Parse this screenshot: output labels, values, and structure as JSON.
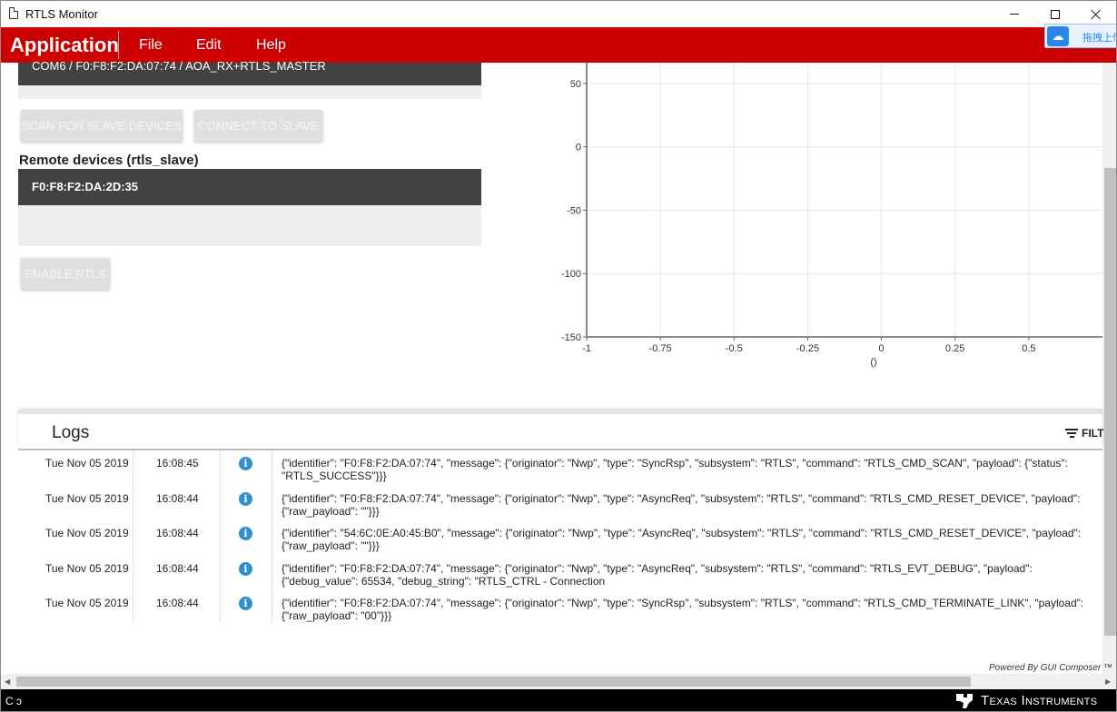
{
  "window": {
    "title": "RTLS Monitor"
  },
  "menubar": {
    "app_title": "Application",
    "items": [
      "File",
      "Edit",
      "Help"
    ],
    "overlay_text": "拖拽上传"
  },
  "left_panel": {
    "port_label": "COM6 / F0:F8:F2:DA:07:74 / AOA_RX+RTLS_MASTER",
    "scan_button": "SCAN FOR SLAVE DEVICES",
    "connect_button": "CONNECT TO SLAVE",
    "remote_heading": "Remote devices (rtls_slave)",
    "remote_devices": [
      "F0:F8:F2:DA:2D:35"
    ],
    "enable_button": "ENABLE RTLS"
  },
  "chart_data": {
    "type": "scatter",
    "series": [],
    "xlabel": "()",
    "x_ticks": [
      "-1",
      "-0.75",
      "-0.5",
      "-0.25",
      "0",
      "0.25",
      "0.5"
    ],
    "y_ticks": [
      "50",
      "0",
      "-50",
      "-100",
      "-150"
    ],
    "xlim": [
      -1,
      0.5
    ],
    "ylim": [
      -150,
      50
    ],
    "grid": true
  },
  "logs": {
    "title": "Logs",
    "filter_label": "FILT",
    "rows": [
      {
        "date": "Tue Nov 05 2019",
        "time": "16:08:45",
        "level_icon": "info-icon",
        "message": "{\"identifier\": \"F0:F8:F2:DA:07:74\", \"message\": {\"originator\": \"Nwp\", \"type\": \"SyncRsp\", \"subsystem\": \"RTLS\", \"command\": \"RTLS_CMD_SCAN\", \"payload\": {\"status\": \"RTLS_SUCCESS\"}}}"
      },
      {
        "date": "Tue Nov 05 2019",
        "time": "16:08:44",
        "level_icon": "info-icon",
        "message": "{\"identifier\": \"F0:F8:F2:DA:07:74\", \"message\": {\"originator\": \"Nwp\", \"type\": \"AsyncReq\", \"subsystem\": \"RTLS\", \"command\": \"RTLS_CMD_RESET_DEVICE\", \"payload\": {\"raw_payload\": \"\"}}}"
      },
      {
        "date": "Tue Nov 05 2019",
        "time": "16:08:44",
        "level_icon": "info-icon",
        "message": "{\"identifier\": \"54:6C:0E:A0:45:B0\", \"message\": {\"originator\": \"Nwp\", \"type\": \"AsyncReq\", \"subsystem\": \"RTLS\", \"command\": \"RTLS_CMD_RESET_DEVICE\", \"payload\": {\"raw_payload\": \"\"}}}"
      },
      {
        "date": "Tue Nov 05 2019",
        "time": "16:08:44",
        "level_icon": "info-icon",
        "message": "{\"identifier\": \"F0:F8:F2:DA:07:74\", \"message\": {\"originator\": \"Nwp\", \"type\": \"AsyncReq\", \"subsystem\": \"RTLS\", \"command\": \"RTLS_EVT_DEBUG\", \"payload\": {\"debug_value\": 65534, \"debug_string\": \"RTLS_CTRL - Connection\nHandle invalid\"}}}"
      },
      {
        "date": "Tue Nov 05 2019",
        "time": "16:08:44",
        "level_icon": "info-icon",
        "message": "{\"identifier\": \"F0:F8:F2:DA:07:74\", \"message\": {\"originator\": \"Nwp\", \"type\": \"SyncRsp\", \"subsystem\": \"RTLS\", \"command\": \"RTLS_CMD_TERMINATE_LINK\", \"payload\": {\"raw_payload\": \"00\"}}}"
      }
    ],
    "powered_by": "Powered By GUI Composer ™"
  },
  "footer": {
    "left_glyph": "C ↄ",
    "brand": "Texas Instruments"
  },
  "colors": {
    "menubar": "#cc0000",
    "dark_bar": "#424242",
    "info_icon": "#2f8fc9"
  }
}
